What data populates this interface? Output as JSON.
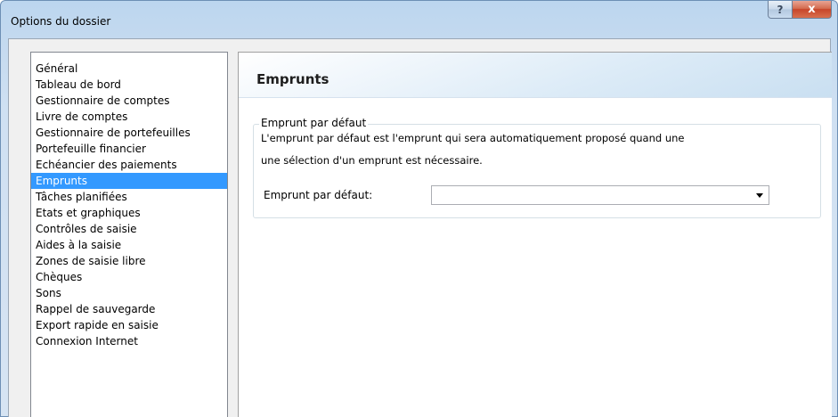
{
  "window": {
    "title": "Options du dossier",
    "help_label": "?",
    "close_label": "x"
  },
  "nav": {
    "items": [
      {
        "label": "Général"
      },
      {
        "label": "Tableau de bord"
      },
      {
        "label": "Gestionnaire de comptes"
      },
      {
        "label": "Livre de comptes"
      },
      {
        "label": "Gestionnaire de portefeuilles"
      },
      {
        "label": "Portefeuille financier"
      },
      {
        "label": "Echéancier des paiements"
      },
      {
        "label": "Emprunts"
      },
      {
        "label": "Tâches planifiées"
      },
      {
        "label": "Etats et graphiques"
      },
      {
        "label": "Contrôles de saisie"
      },
      {
        "label": "Aides à la saisie"
      },
      {
        "label": "Zones de saisie libre"
      },
      {
        "label": "Chèques"
      },
      {
        "label": "Sons"
      },
      {
        "label": "Rappel de sauvegarde"
      },
      {
        "label": "Export rapide en saisie"
      },
      {
        "label": "Connexion Internet"
      }
    ],
    "selected": "Emprunts"
  },
  "content": {
    "title": "Emprunts",
    "group": {
      "legend": "Emprunt par défaut",
      "description_line1": "L'emprunt par défaut est l'emprunt qui sera automatiquement proposé quand une",
      "description_line2": "une sélection d'un emprunt est nécessaire.",
      "field_label": "Emprunt par défaut:",
      "field_value": ""
    }
  },
  "icons": {
    "help": "help-icon",
    "close": "close-icon",
    "dropdown": "chevron-down-icon"
  }
}
